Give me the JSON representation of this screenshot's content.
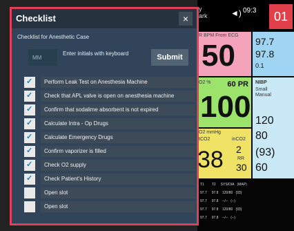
{
  "monitor": {
    "top_left": "y\nark",
    "time": "09:3",
    "badge": "01",
    "hr": {
      "label": "R  BPM    From ECG",
      "value": "50"
    },
    "temps": [
      "97.7",
      "97.8",
      "0.1"
    ],
    "spo2": {
      "label": "O2  %",
      "pr": "60  PR",
      "value": "100"
    },
    "nibp": {
      "label": "NIBP",
      "sub1": "Small",
      "sub2": "Manual",
      "sys": "120",
      "dia": "80",
      "map": "(93)",
      "pr": "60"
    },
    "co2": {
      "label": "O2    mmHg",
      "et": "tCO2",
      "in": "inCO2",
      "et_val": "38",
      "in_val": "2",
      "rr_lbl": "RR",
      "rr_val": "30"
    },
    "table": {
      "header": [
        "T1",
        "T2",
        "SYS/DIA",
        "(MAP)"
      ],
      "rows": [
        [
          "97.7",
          "97.8",
          "120/80",
          "(93)"
        ],
        [
          "97.7",
          "97.8",
          "--/--",
          "(--)"
        ],
        [
          "97.7",
          "97.8",
          "120/80",
          "(93)"
        ],
        [
          "97.7",
          "97.8",
          "--/--",
          "(--)"
        ]
      ]
    },
    "colors": {
      "pink": "#f5a2bb",
      "green": "#9be36a",
      "yellow": "#efe264",
      "blue": "#9fd4f2"
    }
  },
  "checklist": {
    "title": "Checklist",
    "close_icon": "×",
    "subtitle": "Checklist for Anesthetic Case",
    "initials_placeholder": "MM",
    "hint": "Enter initials with keyboard",
    "submit_label": "Submit",
    "items": [
      {
        "label": "Perform Leak Test on Anesthesia Machine",
        "checked": true
      },
      {
        "label": "Check that APL valve is open on anesthesia machine",
        "checked": true
      },
      {
        "label": "Confirm that sodalime absorbent is not expired",
        "checked": true
      },
      {
        "label": "Calculate Intra - Op Drugs",
        "checked": true
      },
      {
        "label": "Calculate Emergency Drugs",
        "checked": true
      },
      {
        "label": "Confirm vaporizer is filled",
        "checked": true
      },
      {
        "label": "Check O2 supply",
        "checked": true
      },
      {
        "label": "Check Patient's History",
        "checked": true
      },
      {
        "label": "Open slot",
        "checked": false
      },
      {
        "label": "Open slot",
        "checked": false
      }
    ]
  }
}
